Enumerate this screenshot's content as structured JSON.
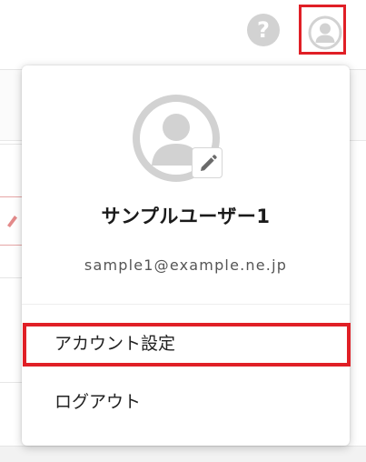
{
  "header": {
    "help_icon": "question-circle-icon",
    "help_glyph": "?",
    "avatar_icon": "user-circle-icon"
  },
  "dropdown": {
    "avatar_icon": "user-circle-icon",
    "edit_icon": "pencil-icon",
    "user_name": "サンプルユーザー1",
    "user_email": "sample1@example.ne.jp",
    "menu_items": [
      {
        "label": "アカウント設定"
      },
      {
        "label": "ログアウト"
      }
    ]
  },
  "colors": {
    "highlight": "#e01f26",
    "icon_gray": "#d2d2d2",
    "text": "#222222"
  }
}
